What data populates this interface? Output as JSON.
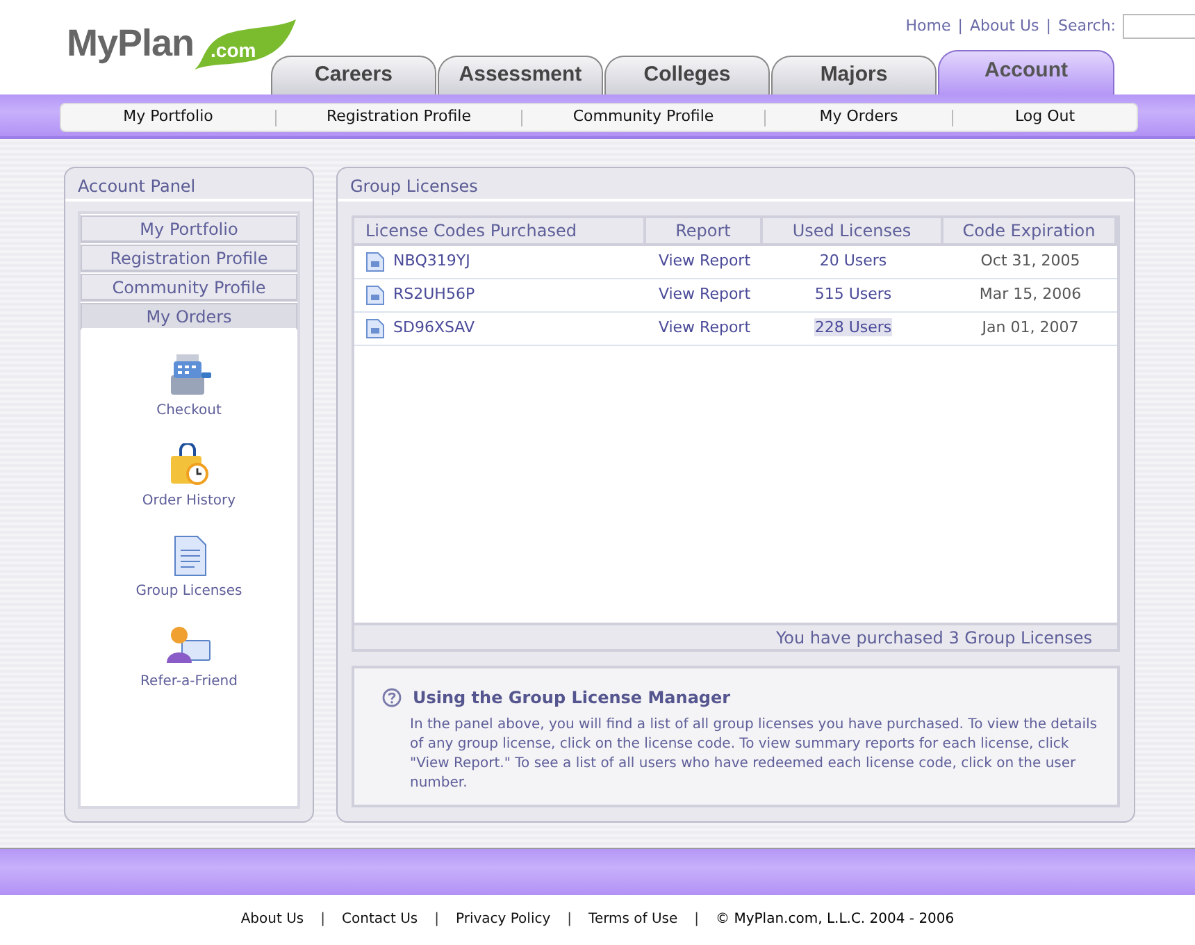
{
  "logo": {
    "name": "MyPlan",
    "suffix": ".com"
  },
  "top_bar": [
    {
      "kind": "link",
      "text": "Home"
    },
    {
      "kind": "sep",
      "text": "|"
    },
    {
      "kind": "link",
      "text": "About Us"
    },
    {
      "kind": "sep",
      "text": "|"
    },
    {
      "kind": "label",
      "text": "Search:"
    },
    {
      "kind": "field"
    }
  ],
  "tabs": [
    {
      "label": "Careers",
      "selected": false
    },
    {
      "label": "Assessment",
      "selected": false
    },
    {
      "label": "Colleges",
      "selected": false
    },
    {
      "label": "Majors",
      "selected": false
    },
    {
      "label": "Account",
      "selected": true
    }
  ],
  "subnav": [
    "My Portfolio",
    "Registration Profile",
    "Community Profile",
    "My Orders",
    "Log Out"
  ],
  "account_panel": {
    "title": "Account Panel",
    "menu": [
      {
        "label": "My Portfolio",
        "selected": false
      },
      {
        "label": "Registration Profile",
        "selected": false
      },
      {
        "label": "Community Profile",
        "selected": false
      },
      {
        "label": "My Orders",
        "selected": true
      }
    ],
    "shortcuts": [
      {
        "kind": "checkout",
        "label": "Checkout"
      },
      {
        "kind": "history",
        "label": "Order History"
      },
      {
        "kind": "licenses",
        "label": "Group Licenses"
      },
      {
        "kind": "refer",
        "label": "Refer-a-Friend"
      }
    ]
  },
  "group_licenses": {
    "title": "Group Licenses",
    "columns": [
      "License Codes Purchased",
      "Report",
      "Used Licenses",
      "Code Expiration"
    ],
    "rows": [
      {
        "code": "NBQ319YJ",
        "report": "View Report",
        "users": "20 Users",
        "expiration": "Oct 31, 2005",
        "hovered": false
      },
      {
        "code": "RS2UH56P",
        "report": "View Report",
        "users": "515 Users",
        "expiration": "Mar 15, 2006",
        "hovered": false
      },
      {
        "code": "SD96XSAV",
        "report": "View Report",
        "users": "228 Users",
        "expiration": "Jan 01, 2007",
        "hovered": true
      }
    ],
    "summary": "You have purchased 3 Group Licenses",
    "help": {
      "title": "Using the Group License Manager",
      "text": "In the panel above, you will find a list of all group licenses you have purchased. To view the details of any group license, click on the license code. To view summary reports for each license, click \"View Report.\" To see a list of all users who have redeemed each license code, click on the user number."
    }
  },
  "footer": [
    {
      "kind": "link",
      "text": "About Us"
    },
    {
      "kind": "sep",
      "text": "|"
    },
    {
      "kind": "link",
      "text": "Contact Us"
    },
    {
      "kind": "sep",
      "text": "|"
    },
    {
      "kind": "link",
      "text": "Privacy Policy"
    },
    {
      "kind": "sep",
      "text": "|"
    },
    {
      "kind": "link",
      "text": "Terms of Use"
    },
    {
      "kind": "sep",
      "text": "|"
    },
    {
      "kind": "label",
      "text": "© MyPlan.com, L.L.C. 2004 - 2006"
    }
  ]
}
